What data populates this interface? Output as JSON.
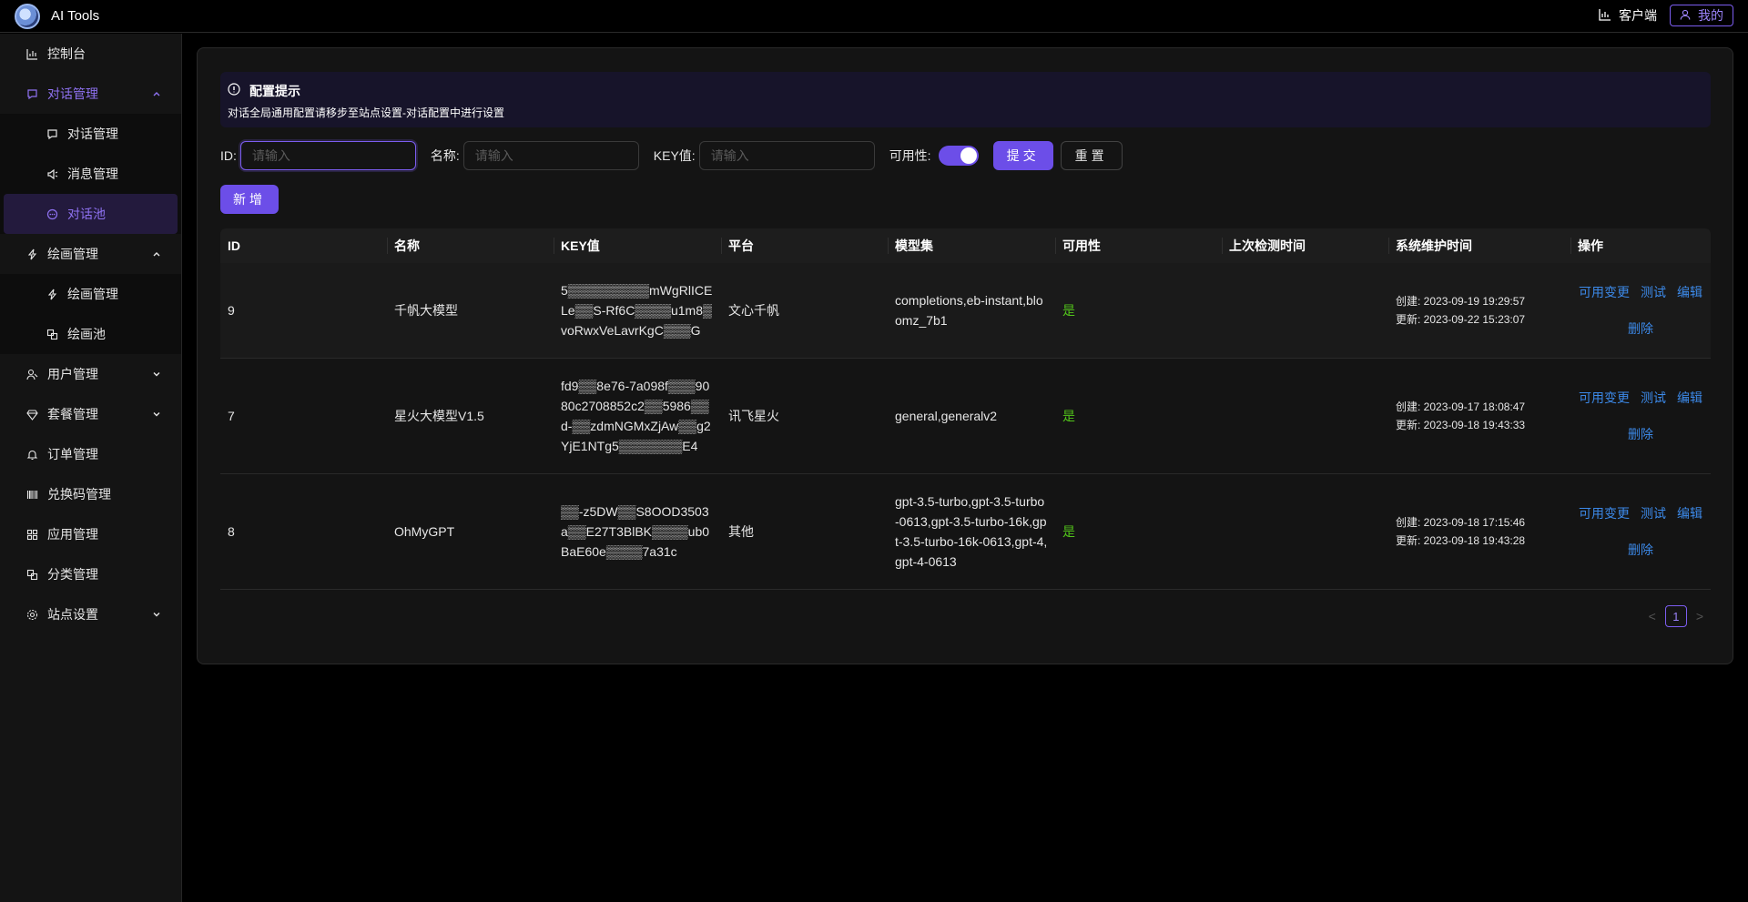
{
  "header": {
    "title": "AI Tools",
    "client_label": "客户端",
    "mine_label": "我的"
  },
  "sidebar": {
    "items": [
      {
        "label": "控制台",
        "icon": "chart-icon"
      },
      {
        "label": "对话管理",
        "icon": "chat-icon",
        "children": [
          {
            "label": "对话管理",
            "icon": "chat-icon"
          },
          {
            "label": "消息管理",
            "icon": "sound-icon"
          },
          {
            "label": "对话池",
            "icon": "message-pool-icon"
          }
        ]
      },
      {
        "label": "绘画管理",
        "icon": "lightning-icon",
        "children": [
          {
            "label": "绘画管理",
            "icon": "lightning-icon"
          },
          {
            "label": "绘画池",
            "icon": "block-icon"
          }
        ]
      },
      {
        "label": "用户管理",
        "icon": "user-icon"
      },
      {
        "label": "套餐管理",
        "icon": "diamond-icon"
      },
      {
        "label": "订单管理",
        "icon": "bell-icon"
      },
      {
        "label": "兑换码管理",
        "icon": "barcode-icon"
      },
      {
        "label": "应用管理",
        "icon": "grid-icon"
      },
      {
        "label": "分类管理",
        "icon": "block-icon"
      },
      {
        "label": "站点设置",
        "icon": "gear-icon"
      }
    ]
  },
  "alert": {
    "title": "配置提示",
    "description": "对话全局通用配置请移步至站点设置-对话配置中进行设置"
  },
  "filters": {
    "id_label": "ID:",
    "name_label": "名称:",
    "key_label": "KEY值:",
    "avail_label": "可用性:",
    "placeholder": "请输入",
    "submit_label": "提交",
    "reset_label": "重置",
    "add_label": "新增"
  },
  "table": {
    "columns": [
      "ID",
      "名称",
      "KEY值",
      "平台",
      "模型集",
      "可用性",
      "上次检测时间",
      "系统维护时间",
      "操作"
    ],
    "rows": [
      {
        "id": "9",
        "name": "千帆大模型",
        "key": "5▒▒▒▒▒▒▒▒▒mWgRlICELe▒▒S-Rf6C▒▒▒▒u1m8▒voRwxVeLavrKgC▒▒▒G",
        "platform": "文心千帆",
        "models": "completions,eb-instant,bloomz_7b1",
        "available": "是",
        "last_check": "",
        "created": "创建: 2023-09-19 19:29:57",
        "updated": "更新: 2023-09-22 15:23:07"
      },
      {
        "id": "7",
        "name": "星火大模型V1.5",
        "key": "fd9▒▒8e76-7a098f▒▒▒9080c2708852c2▒▒5986▒▒d-▒▒zdmNGMxZjAw▒▒g2YjE1NTg5▒▒▒▒▒▒▒E4",
        "platform": "讯飞星火",
        "models": "general,generalv2",
        "available": "是",
        "last_check": "",
        "created": "创建: 2023-09-17 18:08:47",
        "updated": "更新: 2023-09-18 19:43:33"
      },
      {
        "id": "8",
        "name": "OhMyGPT",
        "key": "▒▒-z5DW▒▒S8OOD3503a▒▒E27T3BlBK▒▒▒▒ub0BaE60e▒▒▒▒7a31c",
        "platform": "其他",
        "models": "gpt-3.5-turbo,gpt-3.5-turbo-0613,gpt-3.5-turbo-16k,gpt-3.5-turbo-16k-0613,gpt-4,gpt-4-0613",
        "available": "是",
        "last_check": "",
        "created": "创建: 2023-09-18 17:15:46",
        "updated": "更新: 2023-09-18 19:43:28"
      }
    ],
    "actions": {
      "toggle": "可用变更",
      "test": "测试",
      "edit": "编辑",
      "delete": "删除"
    }
  },
  "pagination": {
    "current": "1",
    "prev": "<",
    "next": ">"
  },
  "colors": {
    "accent": "#6c4ee8",
    "link": "#3c89e8",
    "success": "#52c41a"
  }
}
